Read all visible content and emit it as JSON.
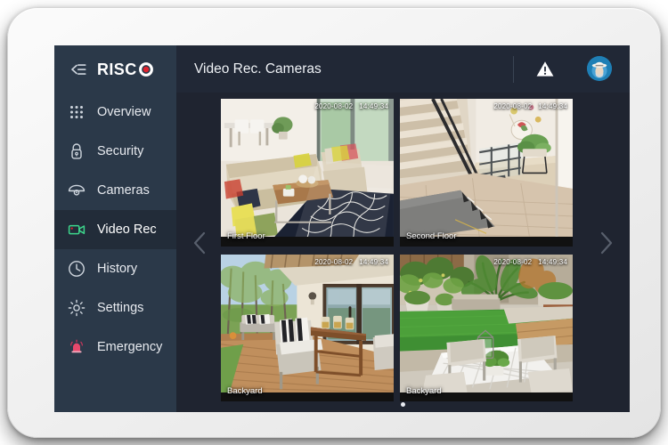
{
  "app": {
    "brand_name": "RISC",
    "brand_mark_color": "#e0232e",
    "page_title": "Video Rec. Cameras",
    "collapse_icon": "collapse-menu-icon",
    "alert_icon": "warning-triangle-icon",
    "avatar_icon": "user-avatar"
  },
  "sidebar": {
    "items": [
      {
        "label": "Overview",
        "icon": "grid-dots-icon",
        "active": false
      },
      {
        "label": "Security",
        "icon": "padlock-icon",
        "active": false
      },
      {
        "label": "Cameras",
        "icon": "dome-camera-icon",
        "active": false
      },
      {
        "label": "Video Rec",
        "icon": "video-camera-icon",
        "active": true
      },
      {
        "label": "History",
        "icon": "clock-icon",
        "active": false
      },
      {
        "label": "Settings",
        "icon": "gear-icon",
        "active": false
      },
      {
        "label": "Emergency",
        "icon": "alarm-siren-icon",
        "active": false
      }
    ]
  },
  "carousel": {
    "prev_icon": "chevron-left-icon",
    "next_icon": "chevron-right-icon",
    "page_count": 1,
    "current_page": 1
  },
  "cameras": [
    {
      "name": "First Floor",
      "date": "2020-08-02",
      "time": "14:49:34"
    },
    {
      "name": "Second Floor",
      "date": "2020-08-02",
      "time": "14:49:34"
    },
    {
      "name": "Backyard",
      "date": "2020-08-02",
      "time": "14:49:34"
    },
    {
      "name": "Backyard",
      "date": "2020-08-02",
      "time": "14:49:34"
    }
  ],
  "colors": {
    "sidebar_bg": "#2b3949",
    "content_bg": "#1f2430",
    "topbar_right_bg": "#212836",
    "active_item_bg": "#222c39",
    "accent_green": "#3dd68c",
    "accent_red": "#e0232e",
    "emergency_red": "#e8486b"
  }
}
